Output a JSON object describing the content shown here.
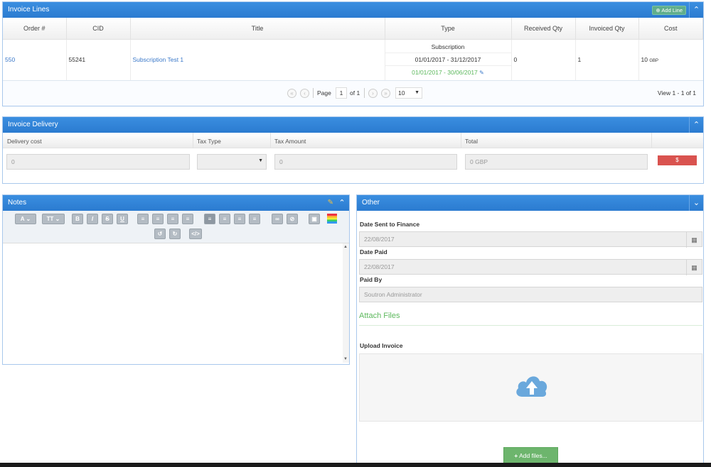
{
  "invoice_lines": {
    "title": "Invoice Lines",
    "add_line": "Add Line",
    "columns": [
      "Order #",
      "CID",
      "Title",
      "Type",
      "Received Qty",
      "Invoiced Qty",
      "Cost"
    ],
    "row": {
      "order": "550",
      "cid": "55241",
      "title": "Subscription Test 1",
      "type": "Subscription",
      "period1": "01/01/2017 - 31/12/2017",
      "period2": "01/01/2017 - 30/06/2017",
      "received": "0",
      "invoiced": "1",
      "cost": "10",
      "currency": "GBP"
    },
    "pager": {
      "page_label": "Page",
      "page": "1",
      "of": "of 1",
      "page_size": "10",
      "view": "View 1 - 1 of 1"
    }
  },
  "delivery": {
    "title": "Invoice Delivery",
    "columns": [
      "Delivery cost",
      "Tax Type",
      "Tax Amount",
      "Total"
    ],
    "cost": "0",
    "tax_amount": "0",
    "total": "0 GBP",
    "button": "$"
  },
  "notes": {
    "title": "Notes"
  },
  "other": {
    "title": "Other",
    "date_sent_label": "Date Sent to Finance",
    "date_sent": "22/08/2017",
    "date_paid_label": "Date Paid",
    "date_paid": "22/08/2017",
    "paid_by_label": "Paid By",
    "paid_by": "Soutron Administrator",
    "attach_files": "Attach Files",
    "upload_label": "Upload Invoice",
    "add_files": "Add files..."
  },
  "toolbar": {
    "font_color": "A",
    "font_size": "T",
    "bold": "B",
    "italic": "I",
    "strike": "S",
    "underline": "U"
  },
  "colors": {
    "header_blue": "#2b7bd0",
    "link_blue": "#3a78c9",
    "green": "#5cb85c",
    "red_button": "#d9534f"
  }
}
